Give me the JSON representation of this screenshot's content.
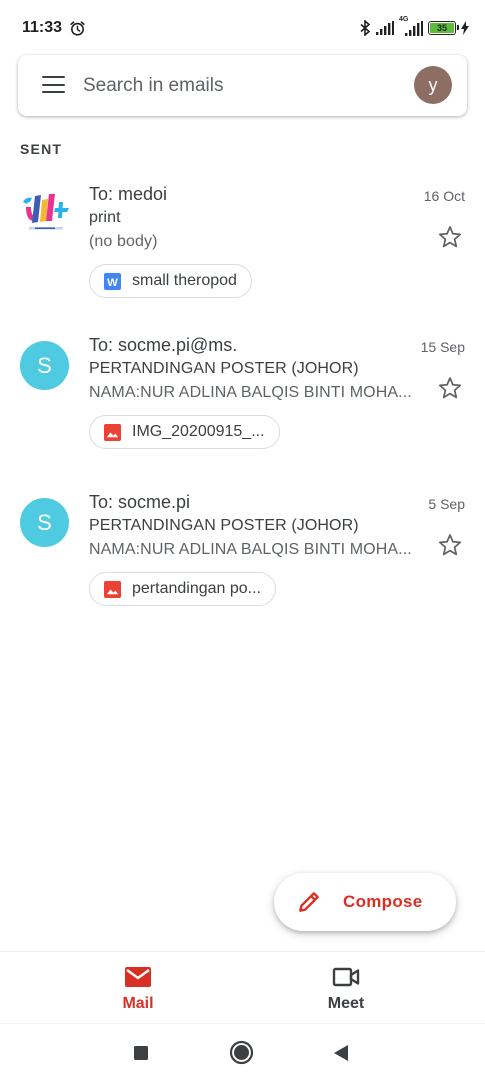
{
  "status_bar": {
    "time": "11:33",
    "network_label": "4G",
    "battery_level": "35"
  },
  "search": {
    "placeholder": "Search in emails",
    "avatar_letter": "y",
    "avatar_color": "#8d6e63"
  },
  "section": {
    "label": "SENT"
  },
  "emails": [
    {
      "recipient": "To: medoi",
      "date": "16 Oct",
      "subject": "print",
      "snippet": "(no body)",
      "attachment": {
        "type": "word-doc-icon",
        "name": "small theropod"
      },
      "avatar": {
        "type": "logo-icon"
      }
    },
    {
      "recipient": "To: socme.pi@ms.",
      "date": "15 Sep",
      "subject": "PERTANDINGAN POSTER (JOHOR)",
      "snippet": "NAMA:NUR ADLINA BALQIS BINTI MOHA...",
      "attachment": {
        "type": "image-icon",
        "name": "IMG_20200915_..."
      },
      "avatar": {
        "letter": "S",
        "color": "#4ecbe0"
      }
    },
    {
      "recipient": "To: socme.pi",
      "date": "5 Sep",
      "subject": "PERTANDINGAN POSTER (JOHOR)",
      "snippet": "NAMA:NUR ADLINA BALQIS BINTI MOHA...",
      "attachment": {
        "type": "image-icon",
        "name": "pertandingan po..."
      },
      "avatar": {
        "letter": "S",
        "color": "#4ecbe0"
      }
    }
  ],
  "compose": {
    "label": "Compose",
    "color": "#d93025"
  },
  "bottom_nav": {
    "mail": {
      "label": "Mail",
      "active": true,
      "color": "#d93025"
    },
    "meet": {
      "label": "Meet",
      "active": false,
      "color": "#3c4043"
    }
  },
  "system_nav": {
    "buttons": [
      "recents-icon",
      "home-icon",
      "back-icon"
    ]
  }
}
